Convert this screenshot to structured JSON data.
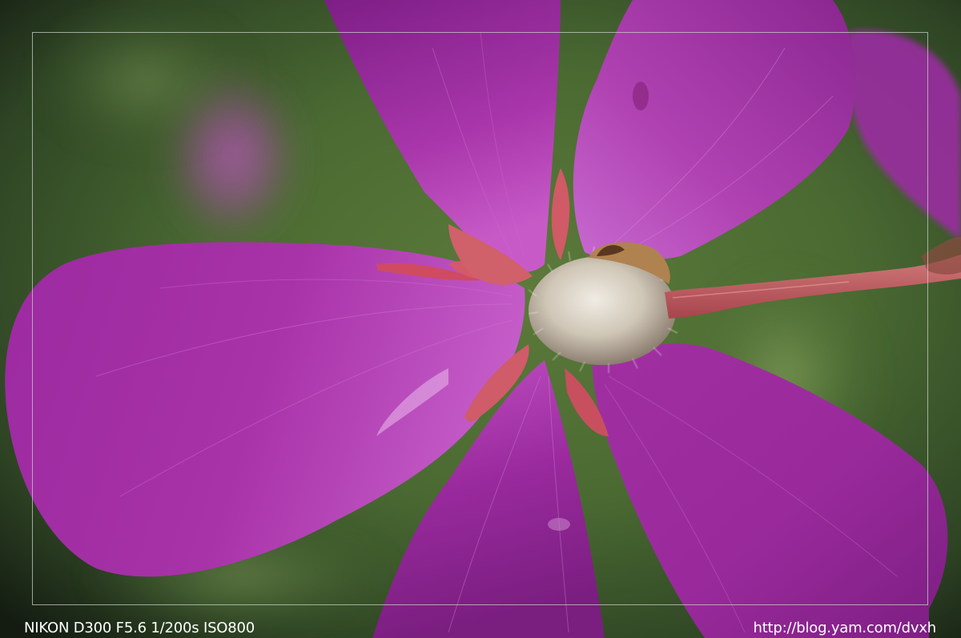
{
  "photo": {
    "subject": "purple-flower-macro",
    "colors": {
      "petal": "#a22ba6",
      "petal_light": "#c24fc4",
      "background": "#3f5d2c",
      "stem": "#c45a62",
      "border": "#c8cdc8",
      "caption_text": "#ffffff"
    }
  },
  "captions": {
    "exif": "NIKON D300 F5.6 1/200s ISO800",
    "url": "http://blog.yam.com/dvxh"
  }
}
